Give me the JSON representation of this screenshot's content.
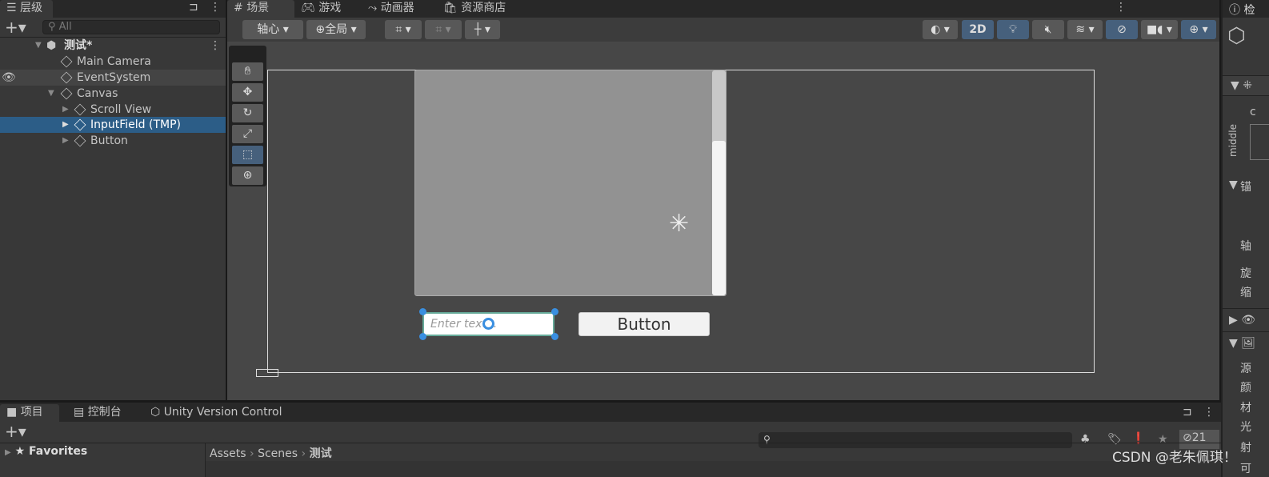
{
  "hierarchy": {
    "tab": "层级",
    "search_placeholder": "All",
    "scene": "测试*",
    "items": [
      {
        "label": "Main Camera"
      },
      {
        "label": "EventSystem"
      },
      {
        "label": "Canvas"
      },
      {
        "label": "Scroll View"
      },
      {
        "label": "InputField (TMP)",
        "selected": true
      },
      {
        "label": "Button"
      }
    ]
  },
  "scene_tabs": [
    {
      "label": "场景",
      "icon": "grid-icon"
    },
    {
      "label": "游戏",
      "icon": "gamepad-icon"
    },
    {
      "label": "动画器",
      "icon": "animator-icon"
    },
    {
      "label": "资源商店",
      "icon": "bag-icon"
    }
  ],
  "scene_toolbar": {
    "pivot": "轴心",
    "space": "全局",
    "mode_2d": "2D"
  },
  "scene": {
    "input_placeholder": "Enter text...",
    "button_label": "Button",
    "scrollbar_value": 0.3
  },
  "inspector": {
    "tab": "检",
    "labels": [
      "c",
      "middle",
      "锚",
      "轴",
      "旋",
      "缩",
      "源",
      "颜",
      "材",
      "光",
      "射",
      "可"
    ]
  },
  "bottom": {
    "tabs": [
      "项目",
      "控制台",
      "Unity Version Control"
    ],
    "favorites": "Favorites",
    "breadcrumb": [
      "Assets",
      "Scenes",
      "测试"
    ],
    "hidden_count": "21"
  },
  "watermark": "CSDN @老朱佩琪！",
  "colors": {
    "selection": "#2c5d87",
    "active_button": "#46607c",
    "viewport": "#474747"
  }
}
